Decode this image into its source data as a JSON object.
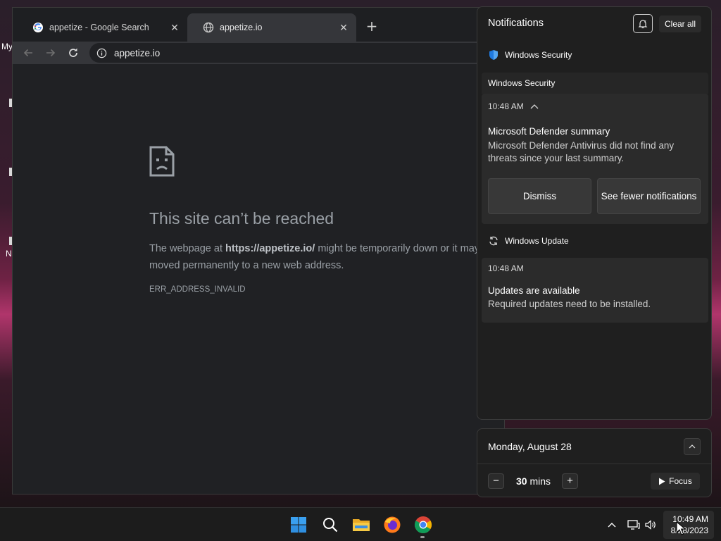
{
  "desktop": {
    "label_1": "My",
    "label_2": "N"
  },
  "browser": {
    "tabs": [
      {
        "title": "appetize - Google Search",
        "favicon": "google-icon",
        "active": false
      },
      {
        "title": "appetize.io",
        "favicon": "globe-icon",
        "active": true
      }
    ],
    "new_tab_label": "+",
    "close_glyph": "✕",
    "address": "appetize.io",
    "error": {
      "title": "This site can’t be reached",
      "body_prefix": "The webpage at ",
      "body_url": "https://appetize.io/",
      "body_suffix": " might be temporarily down or it may have moved permanently to a new web address.",
      "code": "ERR_ADDRESS_INVALID"
    }
  },
  "notifications": {
    "title": "Notifications",
    "clear_all": "Clear all",
    "groups": [
      {
        "app": "Windows Security",
        "icon": "shield-icon",
        "header": "Windows Security",
        "time": "10:48 AM",
        "title": "Microsoft Defender summary",
        "body": "Microsoft Defender Antivirus did not find any threats since your last summary.",
        "actions": [
          "Dismiss",
          "See fewer notifications"
        ]
      },
      {
        "app": "Windows Update",
        "icon": "sync-icon",
        "time": "10:48 AM",
        "title": "Updates are available",
        "body": "Required updates need to be installed."
      }
    ]
  },
  "calendar": {
    "date": "Monday, August 28",
    "focus_minutes": "30",
    "focus_unit": "mins",
    "minus": "−",
    "plus": "+",
    "focus_label": "Focus"
  },
  "taskbar": {
    "apps": [
      "start-icon",
      "search-icon",
      "file-explorer-icon",
      "firefox-icon",
      "chrome-icon"
    ],
    "clock_time": "10:49 AM",
    "clock_date": "8/28/2023"
  },
  "colors": {
    "accent": "#0078d4",
    "error_text": "#9aa0a6",
    "panel_bg": "#1f1f1f"
  }
}
